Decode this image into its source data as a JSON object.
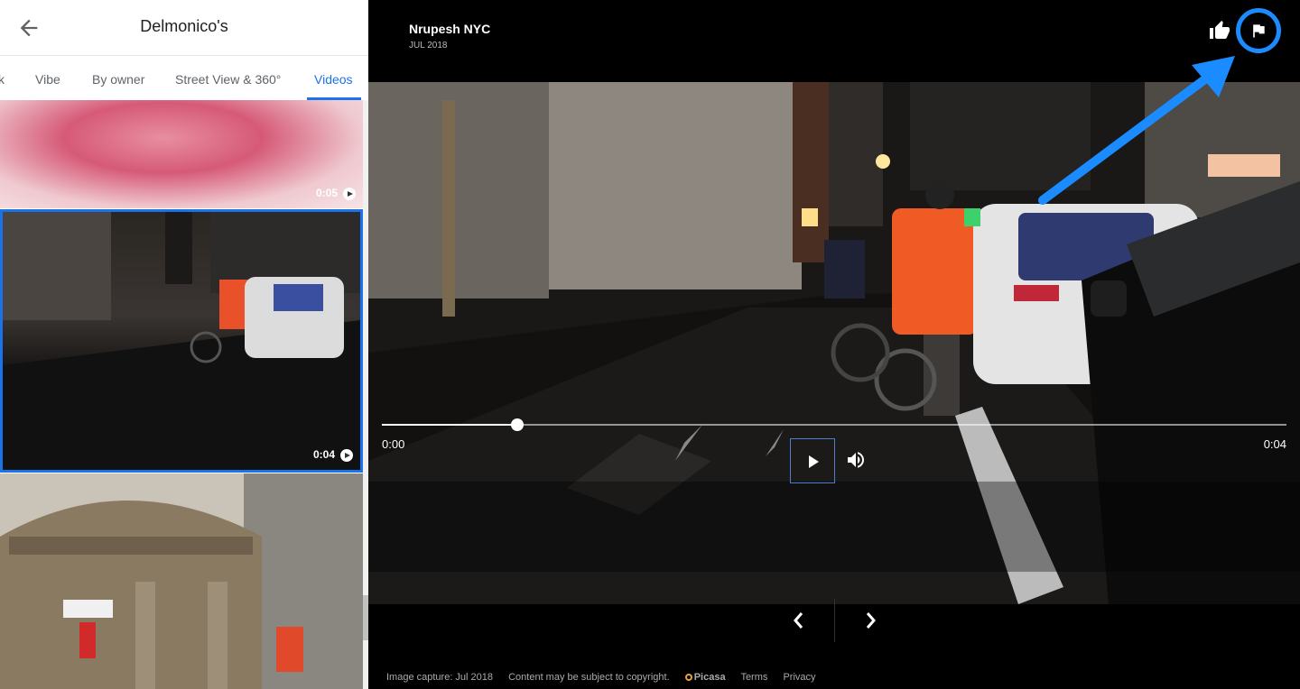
{
  "place": {
    "title": "Delmonico's"
  },
  "tabs": [
    {
      "label": "k"
    },
    {
      "label": "Vibe"
    },
    {
      "label": "By owner"
    },
    {
      "label": "Street View & 360°"
    },
    {
      "label": "Videos",
      "active": true
    }
  ],
  "thumbnails": [
    {
      "duration": "0:05",
      "selected": false
    },
    {
      "duration": "0:04",
      "selected": true
    },
    {
      "duration": ""
    }
  ],
  "viewer": {
    "author": "Nrupesh NYC",
    "date": "JUL 2018",
    "progress_fraction": 0.15,
    "time_current": "0:00",
    "time_duration": "0:04"
  },
  "footer": {
    "capture": "Image capture: Jul 2018",
    "copyright": "Content may be subject to copyright.",
    "picasa": "Picasa",
    "terms": "Terms",
    "privacy": "Privacy"
  },
  "colors": {
    "accent": "#1a73e8",
    "flag_highlight": "#1a8cff"
  },
  "icons": [
    "back-arrow-icon",
    "thumbs-up-icon",
    "flag-icon",
    "play-icon",
    "volume-icon",
    "chevron-left-icon",
    "chevron-right-icon",
    "collapse-icon"
  ]
}
